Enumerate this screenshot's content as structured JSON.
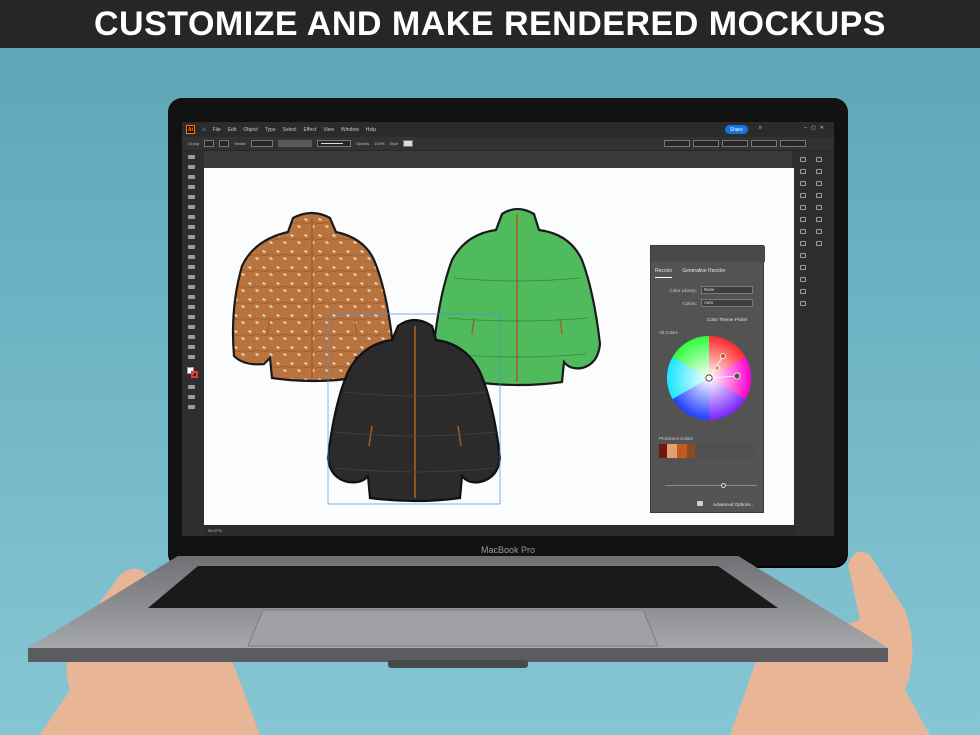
{
  "banner": {
    "text": "CUSTOMIZE AND MAKE RENDERED MOCKUPS"
  },
  "laptop": {
    "brand": "MacBook Pro"
  },
  "app": {
    "logo": "Ai",
    "menu": [
      "File",
      "Edit",
      "Object",
      "Type",
      "Select",
      "Effect",
      "View",
      "Window",
      "Help"
    ],
    "share_label": "Share",
    "zoom_text": "55.57%",
    "toolbar": {
      "group_label": "Group",
      "stroke_label": "Stroke",
      "opacity_label": "Opacity",
      "opacity_value": "100%",
      "style_label": "Style"
    }
  },
  "recolor_panel": {
    "tabs": [
      "Recolor",
      "Generative Recolor"
    ],
    "color_library_label": "Color Library:",
    "color_library_value": "None",
    "colors_label": "Colors:",
    "colors_value": "Auto",
    "color_theme_picker": "Color Theme Picker",
    "all_colors_label": "All Colors",
    "prominent_colors_label": "Prominent Colors",
    "advanced_options": "Advanced Options...",
    "prominent_colors": [
      "#6a1a12",
      "#e0a070",
      "#c05a20",
      "#8a4a22",
      "#505050"
    ]
  },
  "colors": {
    "banner_bg": "#262626",
    "background": "#6fb4c4",
    "jacket_brown": "#b8733e",
    "jacket_green": "#4fbb5d",
    "jacket_black": "#2b2b2b",
    "share_blue": "#1473e6"
  }
}
